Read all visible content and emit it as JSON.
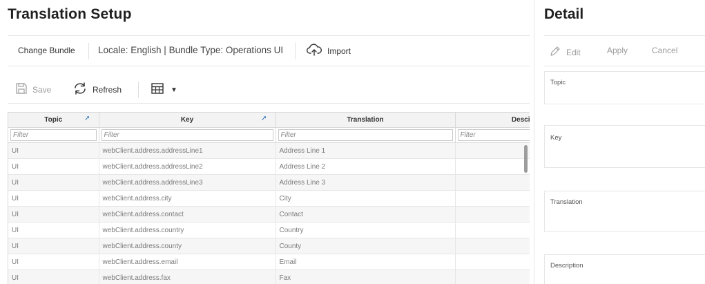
{
  "left": {
    "title": "Translation Setup",
    "bundle_bar": {
      "change_bundle_label": "Change Bundle",
      "locale_text": "Locale: English | Bundle Type: Operations UI",
      "import_label": "Import"
    },
    "toolbar": {
      "save_label": "Save",
      "refresh_label": "Refresh"
    },
    "table": {
      "columns": [
        "Topic",
        "Key",
        "Translation",
        "Desci"
      ],
      "filter_placeholder": "Filter",
      "rows": [
        [
          "UI",
          "webClient.address.addressLine1",
          "Address Line 1",
          ""
        ],
        [
          "UI",
          "webClient.address.addressLine2",
          "Address Line 2",
          ""
        ],
        [
          "UI",
          "webClient.address.addressLine3",
          "Address Line 3",
          ""
        ],
        [
          "UI",
          "webClient.address.city",
          "City",
          ""
        ],
        [
          "UI",
          "webClient.address.contact",
          "Contact",
          ""
        ],
        [
          "UI",
          "webClient.address.country",
          "Country",
          ""
        ],
        [
          "UI",
          "webClient.address.county",
          "County",
          ""
        ],
        [
          "UI",
          "webClient.address.email",
          "Email",
          ""
        ],
        [
          "UI",
          "webClient.address.fax",
          "Fax",
          ""
        ]
      ]
    }
  },
  "detail": {
    "title": "Detail",
    "edit_label": "Edit",
    "apply_label": "Apply",
    "cancel_label": "Cancel",
    "fields": {
      "topic": "Topic",
      "key": "Key",
      "translation": "Translation",
      "description": "Description"
    }
  },
  "colors": {
    "sort_icon": "#2c6fb7",
    "row_alt": "#f6f6f6",
    "disabled_text": "#9a9a9a"
  }
}
